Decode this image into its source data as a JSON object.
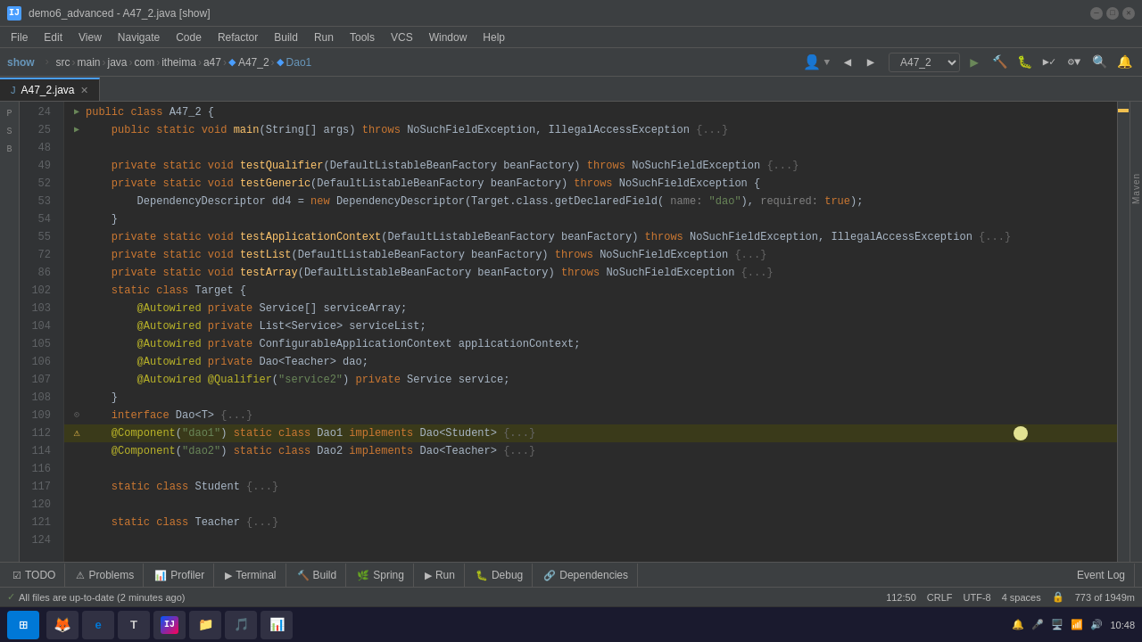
{
  "titlebar": {
    "title": "demo6_advanced - A47_2.java [show]",
    "icon": "IJ"
  },
  "menubar": {
    "items": [
      "File",
      "Edit",
      "View",
      "Navigate",
      "Code",
      "Refactor",
      "Build",
      "Run",
      "Tools",
      "VCS",
      "Window",
      "Help"
    ]
  },
  "toolbar": {
    "show_label": "show",
    "breadcrumb": [
      "src",
      "main",
      "java",
      "com",
      "itheima",
      "a47",
      "A47_2",
      "Dao1"
    ],
    "run_config": "A47_2"
  },
  "tabs": {
    "active": "A47_2.java",
    "items": [
      "A47_2.java"
    ]
  },
  "code": {
    "lines": [
      {
        "num": "24",
        "gutter": "run",
        "text": "public class A47_2 {",
        "indent": 0
      },
      {
        "num": "25",
        "gutter": "run",
        "text": "    public static void main(String[] args) throws NoSuchFieldException, IllegalAccessException {...}",
        "indent": 0
      },
      {
        "num": "48",
        "gutter": "",
        "text": "",
        "indent": 0
      },
      {
        "num": "49",
        "gutter": "",
        "text": "    private static void testQualifier(DefaultListableBeanFactory beanFactory) throws NoSuchFieldException {...}",
        "indent": 0
      },
      {
        "num": "52",
        "gutter": "",
        "text": "    private static void testGeneric(DefaultListableBeanFactory beanFactory) throws NoSuchFieldException {",
        "indent": 0
      },
      {
        "num": "53",
        "gutter": "",
        "text": "        DependencyDescriptor dd4 = new DependencyDescriptor(Target.class.getDeclaredField( name: \"dao\"), required: true);",
        "indent": 0
      },
      {
        "num": "54",
        "gutter": "",
        "text": "    }",
        "indent": 0
      },
      {
        "num": "55",
        "gutter": "",
        "text": "    private static void testApplicationContext(DefaultListableBeanFactory beanFactory) throws NoSuchFieldException, IllegalAccessException {...}",
        "indent": 0
      },
      {
        "num": "72",
        "gutter": "",
        "text": "    private static void testList(DefaultListableBeanFactory beanFactory) throws NoSuchFieldException {...}",
        "indent": 0
      },
      {
        "num": "86",
        "gutter": "",
        "text": "    private static void testArray(DefaultListableBeanFactory beanFactory) throws NoSuchFieldException {...}",
        "indent": 0
      },
      {
        "num": "102",
        "gutter": "",
        "text": "    static class Target {",
        "indent": 0
      },
      {
        "num": "103",
        "gutter": "",
        "text": "        @Autowired private Service[] serviceArray;",
        "indent": 0
      },
      {
        "num": "104",
        "gutter": "",
        "text": "        @Autowired private List<Service> serviceList;",
        "indent": 0
      },
      {
        "num": "105",
        "gutter": "",
        "text": "        @Autowired private ConfigurableApplicationContext applicationContext;",
        "indent": 0
      },
      {
        "num": "106",
        "gutter": "",
        "text": "        @Autowired private Dao<Teacher> dao;",
        "indent": 0
      },
      {
        "num": "107",
        "gutter": "",
        "text": "        @Autowired @Qualifier(\"service2\") private Service service;",
        "indent": 0
      },
      {
        "num": "108",
        "gutter": "",
        "text": "    }",
        "indent": 0
      },
      {
        "num": "109",
        "gutter": "",
        "text": "    interface Dao<T> {...}",
        "indent": 0
      },
      {
        "num": "112",
        "gutter": "warning",
        "text": "    @Component(\"dao1\") static class Dao1 implements Dao<Student> {...}",
        "indent": 0,
        "highlighted": true
      },
      {
        "num": "114",
        "gutter": "",
        "text": "    @Component(\"dao2\") static class Dao2 implements Dao<Teacher> {...}",
        "indent": 0
      },
      {
        "num": "116",
        "gutter": "",
        "text": "",
        "indent": 0
      },
      {
        "num": "117",
        "gutter": "",
        "text": "    static class Student {...}",
        "indent": 0
      },
      {
        "num": "120",
        "gutter": "",
        "text": "",
        "indent": 0
      },
      {
        "num": "121",
        "gutter": "",
        "text": "    static class Teacher {...}",
        "indent": 0
      },
      {
        "num": "124",
        "gutter": "",
        "text": "",
        "indent": 0
      }
    ]
  },
  "bottom_tabs": {
    "items": [
      {
        "icon": "✓",
        "label": "TODO"
      },
      {
        "icon": "⚠",
        "label": "Problems"
      },
      {
        "icon": "📊",
        "label": "Profiler"
      },
      {
        "icon": "▶",
        "label": "Terminal"
      },
      {
        "icon": "🔨",
        "label": "Build"
      },
      {
        "icon": "🌿",
        "label": "Spring"
      },
      {
        "icon": "▶",
        "label": "Run"
      },
      {
        "icon": "🐛",
        "label": "Debug"
      },
      {
        "icon": "🔗",
        "label": "Dependencies"
      }
    ],
    "right": {
      "label": "Event Log"
    }
  },
  "statusbar": {
    "left": "All files are up-to-date (2 minutes ago)",
    "position": "112:50",
    "line_ending": "CRLF",
    "encoding": "UTF-8",
    "indent": "4 spaces",
    "lock_icon": "🔒",
    "location": "773 of 1949m"
  },
  "taskbar": {
    "time": "10:48",
    "apps": [
      {
        "icon": "⊞",
        "label": "Start",
        "color": "#0078d7"
      },
      {
        "icon": "🦊",
        "label": "Firefox"
      },
      {
        "icon": "E",
        "label": "Edge"
      },
      {
        "icon": "T",
        "label": "Text"
      },
      {
        "icon": "☕",
        "label": "IntelliJ"
      },
      {
        "icon": "📁",
        "label": "Files"
      },
      {
        "icon": "🎵",
        "label": "VLC"
      },
      {
        "icon": "📊",
        "label": "PowerPoint"
      }
    ],
    "tray": [
      "🔔",
      "🎤",
      "🖥️",
      "📶",
      "🔊",
      "⌚"
    ]
  },
  "throws_keyword": "throws"
}
